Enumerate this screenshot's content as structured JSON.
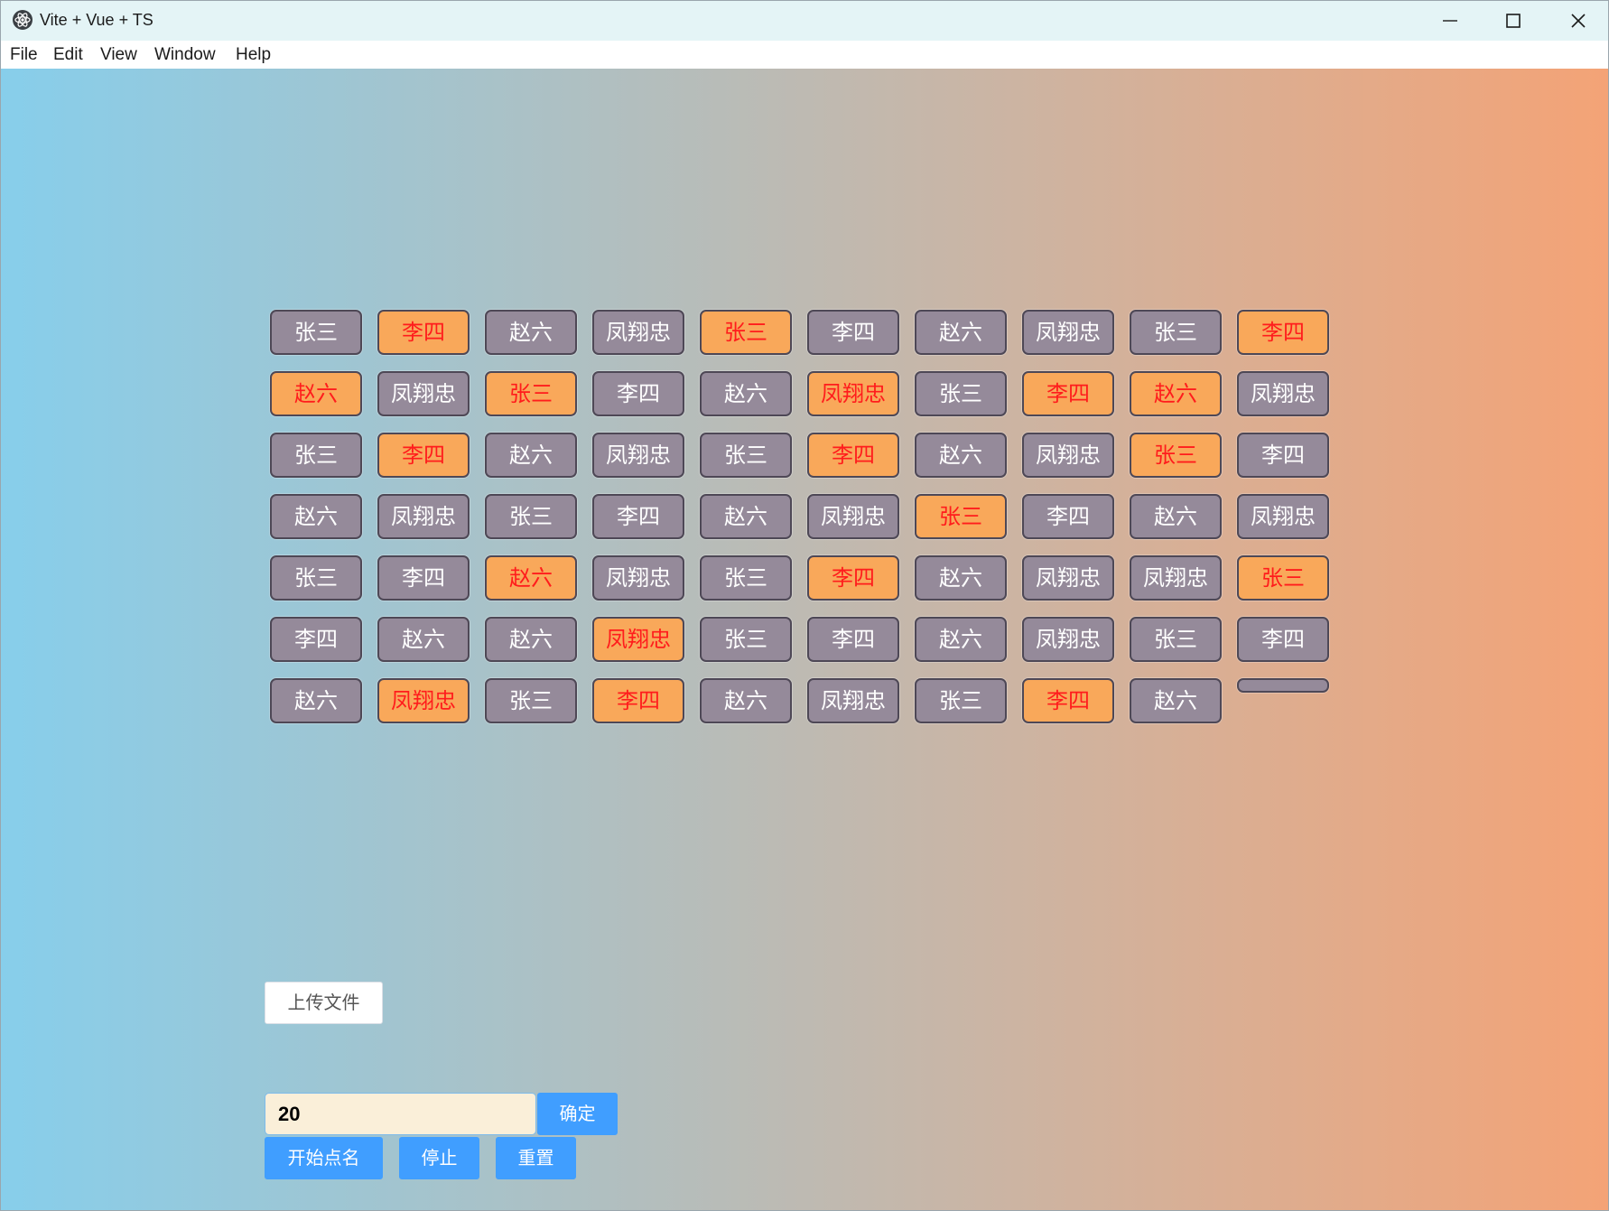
{
  "window": {
    "title": "Vite + Vue + TS"
  },
  "menu": [
    "File",
    "Edit",
    "View",
    "Window",
    "Help"
  ],
  "grid": {
    "rows": [
      [
        {
          "name": "张三",
          "hl": false
        },
        {
          "name": "李四",
          "hl": true
        },
        {
          "name": "赵六",
          "hl": false
        },
        {
          "name": "凤翔忠",
          "hl": false
        },
        {
          "name": "张三",
          "hl": true
        },
        {
          "name": "李四",
          "hl": false
        },
        {
          "name": "赵六",
          "hl": false
        },
        {
          "name": "凤翔忠",
          "hl": false
        },
        {
          "name": "张三",
          "hl": false
        },
        {
          "name": "李四",
          "hl": true
        }
      ],
      [
        {
          "name": "赵六",
          "hl": true
        },
        {
          "name": "凤翔忠",
          "hl": false
        },
        {
          "name": "张三",
          "hl": true
        },
        {
          "name": "李四",
          "hl": false
        },
        {
          "name": "赵六",
          "hl": false
        },
        {
          "name": "凤翔忠",
          "hl": true
        },
        {
          "name": "张三",
          "hl": false
        },
        {
          "name": "李四",
          "hl": true
        },
        {
          "name": "赵六",
          "hl": true
        },
        {
          "name": "凤翔忠",
          "hl": false
        }
      ],
      [
        {
          "name": "张三",
          "hl": false
        },
        {
          "name": "李四",
          "hl": true
        },
        {
          "name": "赵六",
          "hl": false
        },
        {
          "name": "凤翔忠",
          "hl": false
        },
        {
          "name": "张三",
          "hl": false
        },
        {
          "name": "李四",
          "hl": true
        },
        {
          "name": "赵六",
          "hl": false
        },
        {
          "name": "凤翔忠",
          "hl": false
        },
        {
          "name": "张三",
          "hl": true
        },
        {
          "name": "李四",
          "hl": false
        }
      ],
      [
        {
          "name": "赵六",
          "hl": false
        },
        {
          "name": "凤翔忠",
          "hl": false
        },
        {
          "name": "张三",
          "hl": false
        },
        {
          "name": "李四",
          "hl": false
        },
        {
          "name": "赵六",
          "hl": false
        },
        {
          "name": "凤翔忠",
          "hl": false
        },
        {
          "name": "张三",
          "hl": true
        },
        {
          "name": "李四",
          "hl": false
        },
        {
          "name": "赵六",
          "hl": false
        },
        {
          "name": "凤翔忠",
          "hl": false
        }
      ],
      [
        {
          "name": "张三",
          "hl": false
        },
        {
          "name": "李四",
          "hl": false
        },
        {
          "name": "赵六",
          "hl": true
        },
        {
          "name": "凤翔忠",
          "hl": false
        },
        {
          "name": "张三",
          "hl": false
        },
        {
          "name": "李四",
          "hl": true
        },
        {
          "name": "赵六",
          "hl": false
        },
        {
          "name": "凤翔忠",
          "hl": false
        },
        {
          "name": "凤翔忠",
          "hl": false
        },
        {
          "name": "张三",
          "hl": true
        }
      ],
      [
        {
          "name": "李四",
          "hl": false
        },
        {
          "name": "赵六",
          "hl": false
        },
        {
          "name": "赵六",
          "hl": false
        },
        {
          "name": "凤翔忠",
          "hl": true
        },
        {
          "name": "张三",
          "hl": false
        },
        {
          "name": "李四",
          "hl": false
        },
        {
          "name": "赵六",
          "hl": false
        },
        {
          "name": "凤翔忠",
          "hl": false
        },
        {
          "name": "张三",
          "hl": false
        },
        {
          "name": "李四",
          "hl": false
        }
      ],
      [
        {
          "name": "赵六",
          "hl": false
        },
        {
          "name": "凤翔忠",
          "hl": true
        },
        {
          "name": "张三",
          "hl": false
        },
        {
          "name": "李四",
          "hl": true
        },
        {
          "name": "赵六",
          "hl": false
        },
        {
          "name": "凤翔忠",
          "hl": false
        },
        {
          "name": "张三",
          "hl": false
        },
        {
          "name": "李四",
          "hl": true
        },
        {
          "name": "赵六",
          "hl": false
        },
        {
          "name": "",
          "hl": false
        }
      ]
    ]
  },
  "controls": {
    "upload_label": "上传文件",
    "count_value": "20",
    "confirm_label": "确定",
    "start_label": "开始点名",
    "stop_label": "停止",
    "reset_label": "重置"
  },
  "colors": {
    "cell_default": "#958a9a",
    "cell_highlight": "#f9a85a",
    "highlight_text": "#ff1c1c",
    "button_blue": "#409eff"
  }
}
